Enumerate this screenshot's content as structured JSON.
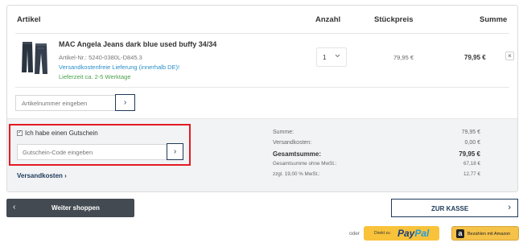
{
  "header": {
    "col_article": "Artikel",
    "col_quantity": "Anzahl",
    "col_unit_price": "Stückpreis",
    "col_sum": "Summe"
  },
  "item": {
    "title": "MAC Angela Jeans dark blue used buffy 34/34",
    "article_nr": "Artikel-Nr.: 5240-0380L-D845.3",
    "shipping_note": "Versandkostenfreie Lieferung (innerhalb DE)!",
    "delivery_time": "Lieferzeit ca. 2-5 Werktage",
    "quantity": "1",
    "unit_price": "79,95 €",
    "sum": "79,95 €",
    "remove_glyph": "×",
    "thumbnail_icon": "jeans-thumbnail"
  },
  "article_input": {
    "placeholder": "Artikelnummer eingeben",
    "button_glyph": "›"
  },
  "voucher": {
    "checkbox_label": "Ich habe einen Gutschein",
    "checked": true,
    "placeholder": "Gutschein-Code eingeben",
    "button_glyph": "›",
    "highlight_color": "#e31b23"
  },
  "shipping_link": "Versandkosten ›",
  "totals": {
    "subtotal_label": "Summe:",
    "subtotal_value": "79,95 €",
    "shipping_label": "Versandkosten:",
    "shipping_value": "0,00 €",
    "total_label": "Gesamtsumme:",
    "total_value": "79,95 €",
    "net_label": "Gesamtsumme ohne MwSt.:",
    "net_value": "67,18 €",
    "vat_label": "zzgl. 19,00 % MwSt.:",
    "vat_value": "12,77 €"
  },
  "actions": {
    "continue_shopping": "Weiter shoppen",
    "continue_arrow": "‹",
    "checkout": "ZUR KASSE",
    "checkout_arrow": "›",
    "or": "oder",
    "paypal_prefix": "Direkt zu",
    "paypal_brand_1": "Pay",
    "paypal_brand_2": "Pal",
    "amazon_logo_letter": "a",
    "amazon_label": "Bezahlen mit Amazon"
  },
  "colors": {
    "brand_navy": "#1d3a59",
    "dark_button": "#444a52",
    "link_blue": "#2a8ec7",
    "delivery_green": "#4aa14a",
    "paypal_yellow": "#f8c33b"
  }
}
